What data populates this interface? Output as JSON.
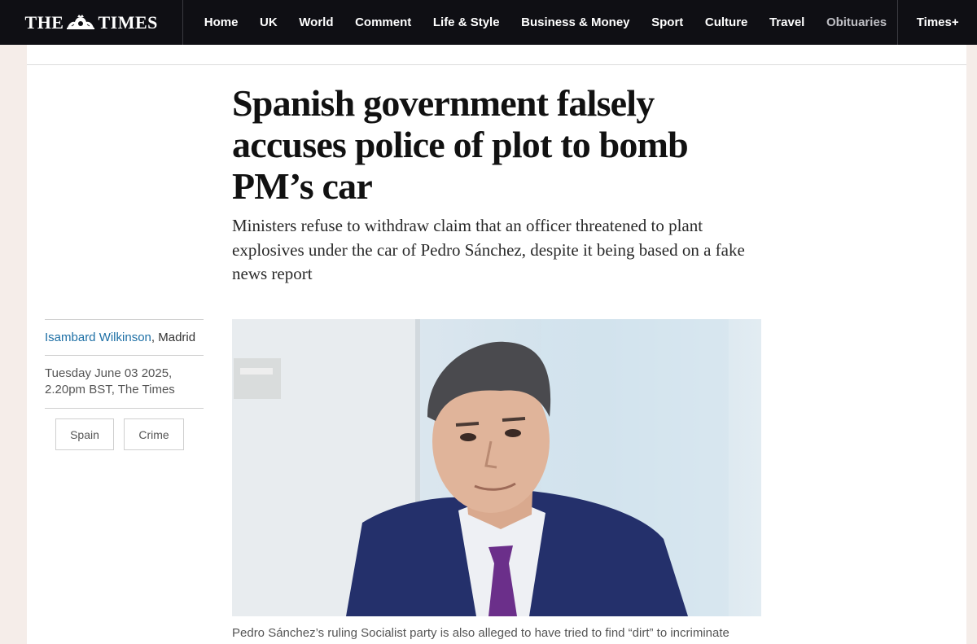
{
  "brand": {
    "logo_left": "THE",
    "logo_right": "TIMES",
    "logo_icon": "royal-crest-icon"
  },
  "nav": {
    "items": [
      "Home",
      "UK",
      "World",
      "Comment",
      "Life & Style",
      "Business & Money",
      "Sport",
      "Culture",
      "Travel",
      "Obituaries"
    ],
    "plus": "Times+"
  },
  "article": {
    "headline": "Spanish government falsely accuses police of plot to bomb PM’s car",
    "standfirst": "Ministers refuse to withdraw claim that an officer threatened to plant explosives under the car of Pedro Sánchez, despite it being based on a fake news report",
    "author": "Isambard Wilkinson",
    "location": ", Madrid",
    "dateline": "Tuesday June 03 2025, 2.20pm BST, The Times",
    "tags": [
      "Spain",
      "Crime"
    ],
    "caption": "Pedro Sánchez’s ruling Socialist party is also alleged to have tried to find “dirt” to incriminate"
  },
  "colors": {
    "topbar": "#0f0f14",
    "link": "#1d6fa5",
    "page_bg": "#f5ede9",
    "suit": "#24306b",
    "tie": "#6b2f8a"
  }
}
